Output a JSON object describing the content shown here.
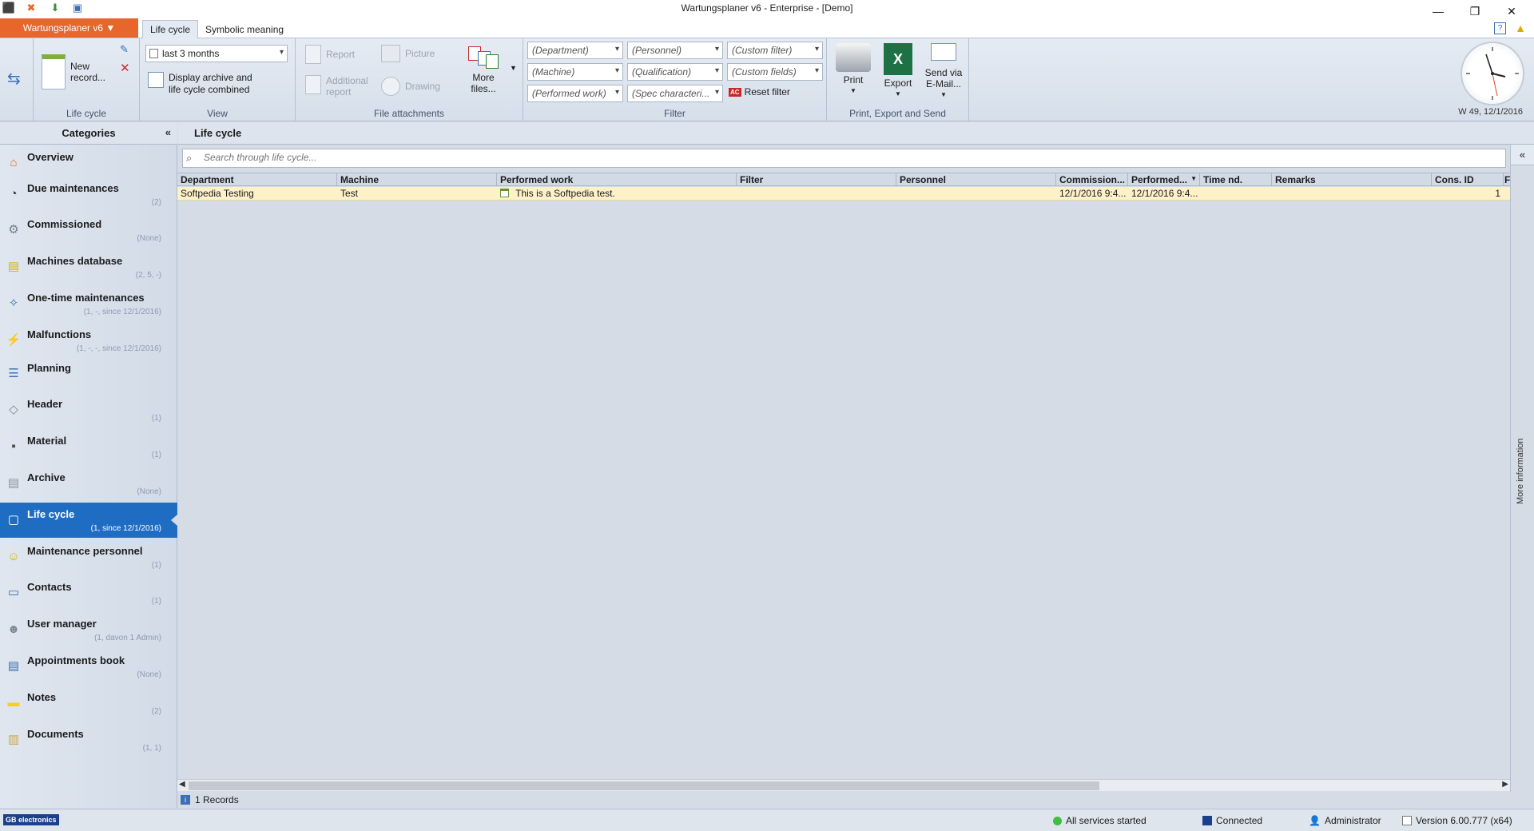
{
  "window": {
    "title": "Wartungsplaner v6 - Enterprise - [Demo]",
    "minimize_icon": "minimize-icon",
    "maximize_icon": "restore-icon",
    "close_icon": "close-icon"
  },
  "ribbon_tabs": {
    "app_menu": "Wartungsplaner v6 ▼",
    "tabs": [
      "Life cycle",
      "Symbolic meaning"
    ]
  },
  "ribbon": {
    "lifecycle": {
      "new_record": "New record...",
      "group_label": "Life cycle"
    },
    "view": {
      "period": "last 3 months",
      "display_archive_line1": "Display archive and",
      "display_archive_line2": "life cycle combined",
      "group_label": "View"
    },
    "attachments": {
      "report": "Report",
      "additional_report": "Additional report",
      "picture": "Picture",
      "drawing": "Drawing",
      "more_files": "More files...",
      "group_label": "File attachments"
    },
    "filter": {
      "department": "(Department)",
      "personnel": "(Personnel)",
      "custom_filter": "(Custom filter)",
      "machine": "(Machine)",
      "qualification": "(Qualification)",
      "custom_fields": "(Custom fields)",
      "performed_work": "(Performed work)",
      "spec": "(Spec characteri...",
      "reset": "Reset filter",
      "group_label": "Filter"
    },
    "output": {
      "print": "Print",
      "export": "Export",
      "send_email": "Send via E-Mail...",
      "group_label": "Print, Export and Send"
    },
    "week_date": "W 49, 12/1/2016"
  },
  "sidebar": {
    "title": "Categories",
    "collapse": "«",
    "items": [
      {
        "label": "Overview",
        "sub": "",
        "icon": "house-icon"
      },
      {
        "label": "Due maintenances",
        "sub": "(2)",
        "icon": "clock-icon"
      },
      {
        "label": "Commissioned",
        "sub": "(None)",
        "icon": "gear-icon"
      },
      {
        "label": "Machines database",
        "sub": "(2, 5, -)",
        "icon": "database-icon"
      },
      {
        "label": "One-time maintenances",
        "sub": "(1, -, since 12/1/2016)",
        "icon": "wrench-icon"
      },
      {
        "label": "Malfunctions",
        "sub": "(1, -, -, since 12/1/2016)",
        "icon": "lightning-icon"
      },
      {
        "label": "Planning",
        "sub": "",
        "icon": "planning-icon"
      },
      {
        "label": "Header",
        "sub": "(1)",
        "icon": "tag-icon"
      },
      {
        "label": "Material",
        "sub": "(1)",
        "icon": "material-icon"
      },
      {
        "label": "Archive",
        "sub": "(None)",
        "icon": "archive-icon"
      },
      {
        "label": "Life cycle",
        "sub": "(1, since 12/1/2016)",
        "icon": "lifecycle-icon"
      },
      {
        "label": "Maintenance personnel",
        "sub": "(1)",
        "icon": "personnel-icon"
      },
      {
        "label": "Contacts",
        "sub": "(1)",
        "icon": "contacts-icon"
      },
      {
        "label": "User manager",
        "sub": "(1, davon 1 Admin)",
        "icon": "user-icon"
      },
      {
        "label": "Appointments book",
        "sub": "(None)",
        "icon": "book-icon"
      },
      {
        "label": "Notes",
        "sub": "(2)",
        "icon": "note-icon"
      },
      {
        "label": "Documents",
        "sub": "(1, 1)",
        "icon": "folder-icon"
      }
    ]
  },
  "main": {
    "title": "Life cycle",
    "search_placeholder": "Search through life cycle...",
    "more_information": "More information",
    "columns": [
      "Department",
      "Machine",
      "Performed work",
      "Filter",
      "Personnel",
      "Commission...",
      "Performed...",
      "Time nd.",
      "Remarks",
      "Cons. ID",
      "F"
    ],
    "rows": [
      {
        "department": "Softpedia Testing",
        "machine": "Test",
        "performed_work": "This is a Softpedia test.",
        "filter": "",
        "personnel": "",
        "commissioned": "12/1/2016 9:4...",
        "performed": "12/1/2016 9:4...",
        "time": "",
        "remarks": "",
        "cons_id": "1"
      }
    ],
    "records": "1 Records"
  },
  "statusbar": {
    "logo": "GB electronics",
    "services": "All services started",
    "connection": "Connected",
    "user": "Administrator",
    "version": "Version 6.00.777 (x64)"
  },
  "colors": {
    "accent_orange": "#e8662b",
    "selection_blue": "#1f6dc3",
    "row_highlight": "#fdf1c8"
  }
}
